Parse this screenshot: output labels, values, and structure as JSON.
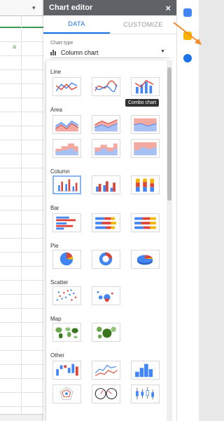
{
  "editor": {
    "title": "Chart editor",
    "close": "×",
    "tabs": {
      "data": "DATA",
      "customize": "CUSTOMIZE"
    },
    "chart_type_label": "Chart type",
    "chart_type_value": "Column chart",
    "tooltip": "Combo chart"
  },
  "sections": {
    "line": "Line",
    "area": "Area",
    "column": "Column",
    "bar": "Bar",
    "pie": "Pie",
    "scatter": "Scatter",
    "map": "Map",
    "other": "Other"
  },
  "icons": {
    "right_strip": [
      "calendar-icon",
      "keep-icon",
      "tasks-icon"
    ],
    "selected_chart": "column-chart"
  },
  "colors": {
    "accent": "#1a73e8",
    "red": "#db4437",
    "blue": "#4285f4",
    "yellow": "#f4b400",
    "green": "#0f9d58",
    "arrow": "#f28b30"
  }
}
